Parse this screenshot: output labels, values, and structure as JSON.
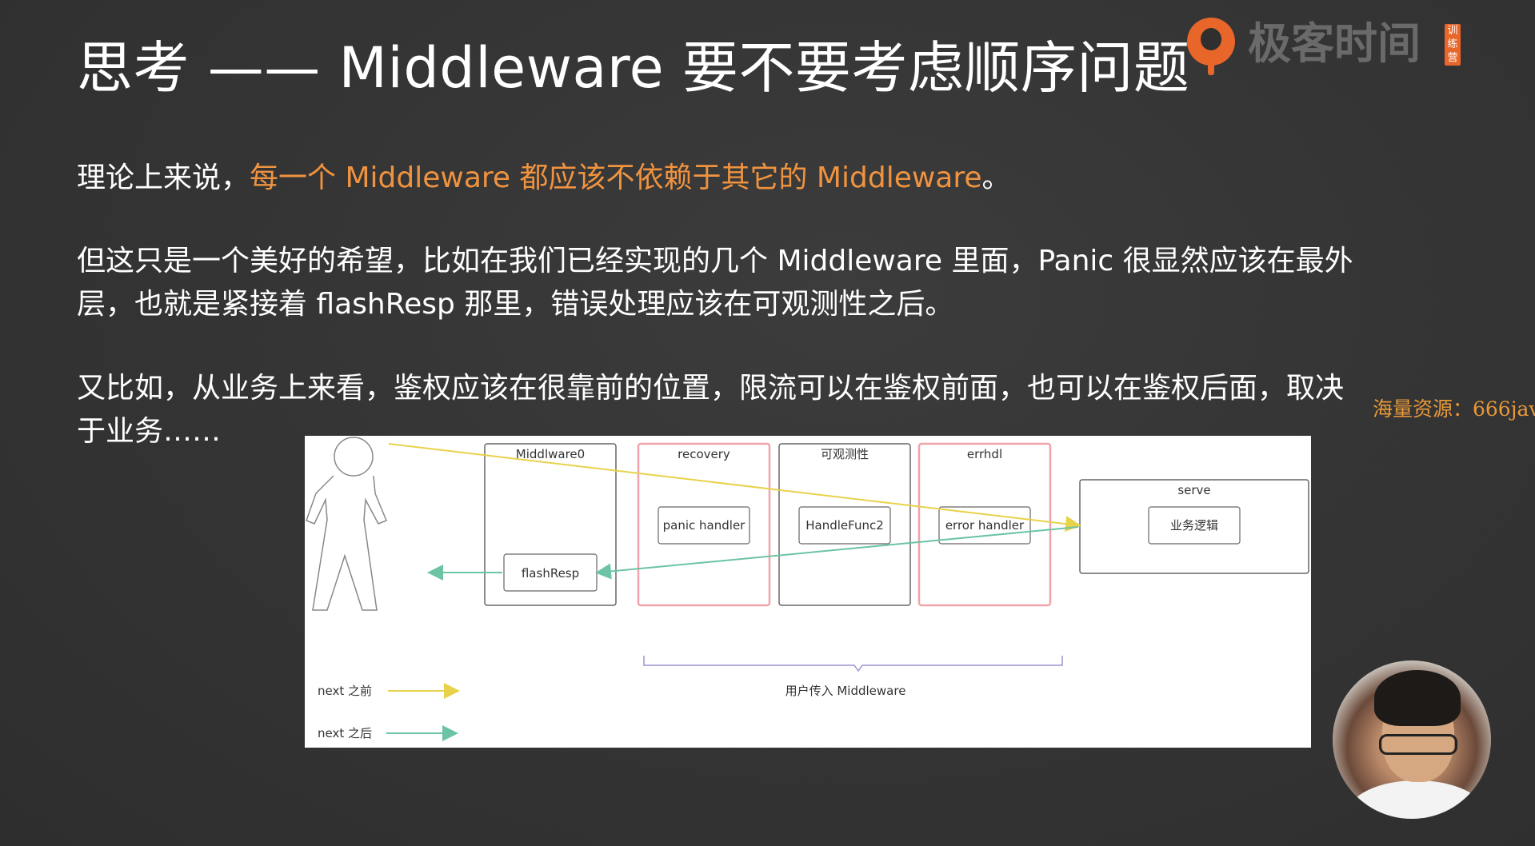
{
  "slide": {
    "title": "思考 —— Middleware 要不要考虑顺序问题",
    "para1_prefix": "理论上来说，",
    "para1_highlight": "每一个 Middleware 都应该不依赖于其它的 Middleware",
    "para1_suffix": "。",
    "para2": "但这只是一个美好的希望，比如在我们已经实现的几个 Middleware 里面，Panic 很显然应该在最外层，也就是紧接着 flashResp 那里，错误处理应该在可观测性之后。",
    "para3": "又比如，从业务上来看，鉴权应该在很靠前的位置，限流可以在鉴权前面，也可以在鉴权后面，取决于业务……"
  },
  "logo": {
    "brand": "极客时间",
    "tag": "训练营",
    "icon": "geektime-logo-icon",
    "color": "#e8662a"
  },
  "watermark": "海量资源：666jav",
  "diagram": {
    "boxes": {
      "middleware0": "Middlware0",
      "recovery": "recovery",
      "observability": "可观测性",
      "errhdl": "errhdl",
      "serve": "serve"
    },
    "inner": {
      "flash_resp": "flashResp",
      "panic_handler": "panic handler",
      "handle_func2": "HandleFunc2",
      "error_handler": "error handler",
      "business_logic": "业务逻辑"
    },
    "brace_label": "用户传入 Middleware",
    "legend": {
      "before": "next 之前",
      "after": "next 之后"
    },
    "colors": {
      "before_arrow": "#e8d24a",
      "after_arrow": "#6cc4a4",
      "highlight_border": "#f0a3ab",
      "brace": "#9b93cf"
    },
    "icon": "person-icon"
  },
  "presenter": {
    "icon": "presenter-avatar"
  }
}
